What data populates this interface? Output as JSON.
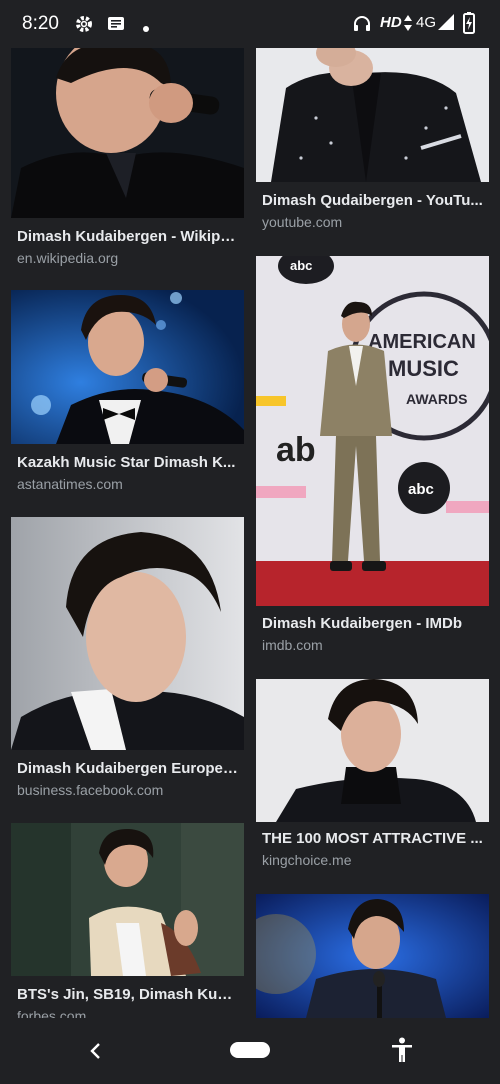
{
  "status_bar": {
    "time": "8:20",
    "icons": [
      "settings-icon",
      "message-icon",
      "dot-icon",
      "headset-icon",
      "data-arrows-icon",
      "signal-icon",
      "battery-charging-icon"
    ],
    "hd_label": "HD",
    "network_label": "4G"
  },
  "results": [
    {
      "title": "Dimash Kudaibergen - Wikipe...",
      "domain": "en.wikipedia.org"
    },
    {
      "title": "Dimash Qudaibergen - YouTu...",
      "domain": "youtube.com"
    },
    {
      "title": "Kazakh Music Star Dimash K...",
      "domain": "astanatimes.com"
    },
    {
      "title": "Dimash Kudaibergen - IMDb",
      "domain": "imdb.com"
    },
    {
      "title": "Dimash Kudaibergen Europe -...",
      "domain": "business.facebook.com"
    },
    {
      "title": "THE 100 MOST ATTRACTIVE ...",
      "domain": "kingchoice.me"
    },
    {
      "title": "BTS's Jin, SB19, Dimash Kuda...",
      "domain": "forbes.com"
    },
    {
      "title": "",
      "domain": ""
    }
  ],
  "nav_bar": {
    "back": "back-icon",
    "home": "home-pill",
    "accessibility": "accessibility-icon"
  }
}
